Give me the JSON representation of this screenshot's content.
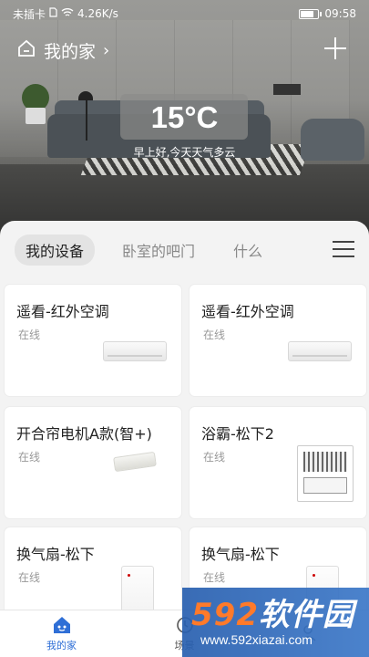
{
  "status_bar": {
    "carrier": "未插卡",
    "net_speed": "4.26K/s",
    "time": "09:58"
  },
  "header": {
    "home_name": "我的家",
    "chevron": "›",
    "add_icon": "plus-icon"
  },
  "weather": {
    "temperature": "15°C",
    "greeting": "早上好,今天天气多云"
  },
  "tabs": [
    {
      "label": "我的设备",
      "active": true
    },
    {
      "label": "卧室的吧门",
      "active": false
    },
    {
      "label": "什么",
      "active": false
    }
  ],
  "devices": [
    {
      "name": "遥看-红外空调",
      "status": "在线",
      "icon": "air-conditioner"
    },
    {
      "name": "遥看-红外空调",
      "status": "在线",
      "icon": "air-conditioner"
    },
    {
      "name": "开合帘电机A款(智+)",
      "status": "在线",
      "icon": "curtain-motor"
    },
    {
      "name": "浴霸-松下2",
      "status": "在线",
      "icon": "bath-heater"
    },
    {
      "name": "换气扇-松下",
      "status": "在线",
      "icon": "ventilation-fan"
    },
    {
      "name": "换气扇-松下",
      "status": "在线",
      "icon": "ventilation-fan"
    }
  ],
  "bottom_nav": [
    {
      "label": "我的家",
      "icon": "home-icon",
      "active": true
    },
    {
      "label": "场景",
      "icon": "scene-icon",
      "active": false
    },
    {
      "label": "",
      "icon": "profile-icon",
      "active": false
    }
  ],
  "watermark": {
    "brand_num": "592",
    "brand_text": "软件园",
    "url": "www.592xiazai.com"
  },
  "colors": {
    "accent": "#2f6fd6",
    "panel_bg": "#f3f3f3"
  }
}
